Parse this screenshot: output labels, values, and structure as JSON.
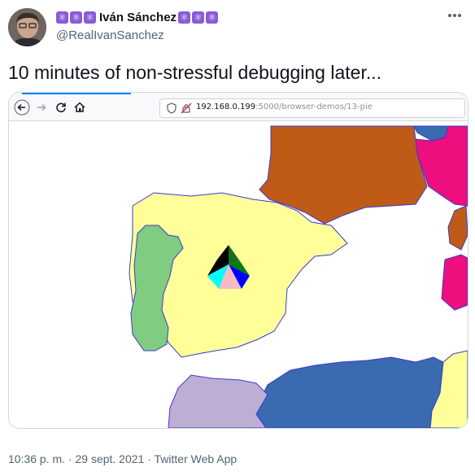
{
  "author": {
    "name": "Iván Sánchez",
    "handle": "@RealIvanSanchez",
    "emoji_icon": "atom-symbol-icon"
  },
  "tweet": {
    "text": "10 minutes of non-stressful debugging later..."
  },
  "browser": {
    "url_host": "192.168.0.199",
    "url_path": ":5000/browser-demos/13-pie"
  },
  "footer": {
    "timestamp": "10:36 p. m. · 29 sept. 2021 · Twitter Web App"
  },
  "colors": {
    "spain": "#ffff99",
    "portugal": "#80cc80",
    "france": "#c05a17",
    "africa_blue": "#3a6ab0",
    "africa_purple": "#beaed4",
    "magenta": "#ee0e7e",
    "border": "#3a3ad0"
  }
}
